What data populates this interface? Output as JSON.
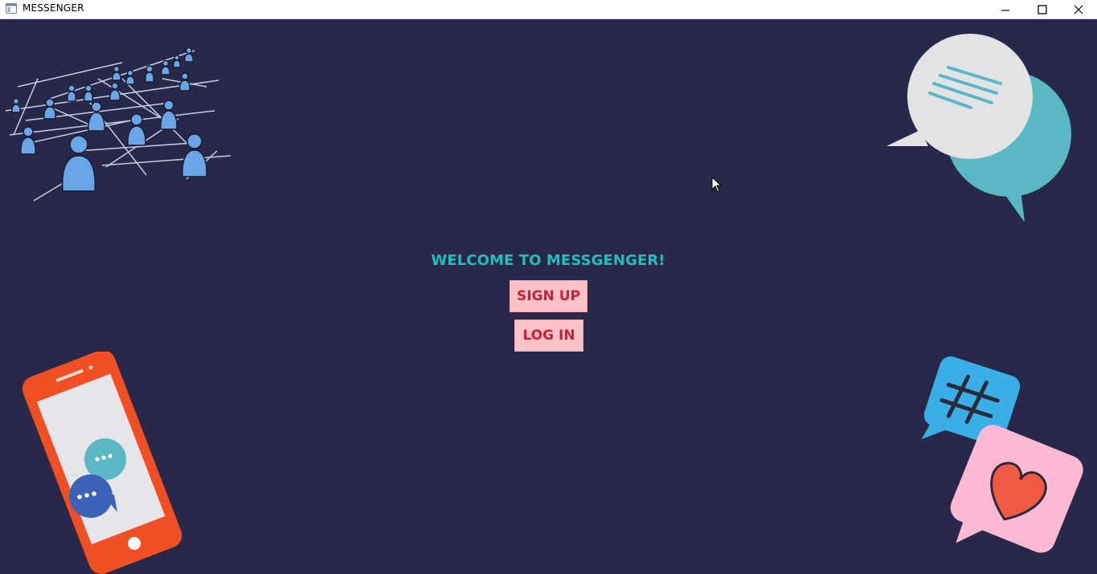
{
  "window": {
    "title": "MESSENGER",
    "controls": {
      "minimize": "minimize-icon",
      "maximize": "maximize-icon",
      "close": "close-icon"
    }
  },
  "main": {
    "welcome_text": "WELCOME TO MESSGENGER!",
    "signup_label": "SIGN UP",
    "login_label": "LOG IN"
  },
  "illustrations": [
    "network-people-icon",
    "speech-bubbles-icon",
    "phone-chat-icon",
    "hashtag-heart-bubbles-icon"
  ],
  "colors": {
    "background": "#28294a",
    "welcome": "#1fbfbd",
    "button_bg": "#fdc2c8",
    "button_text": "#c9203a"
  }
}
